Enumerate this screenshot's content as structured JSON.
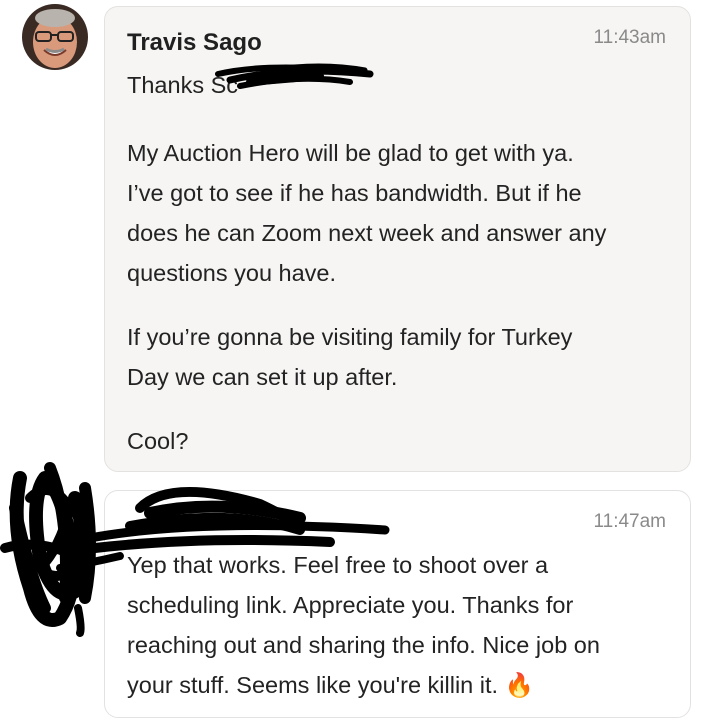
{
  "messages": [
    {
      "sender": "Travis Sago",
      "time": "11:43am",
      "greeting": "Thanks Sc",
      "paragraphs": [
        [
          "My Auction Hero will be glad to get with ya.",
          "I’ve got to see if he has bandwidth. But if he",
          "does he can Zoom next week and answer any",
          "questions you have."
        ],
        [
          "If you’re gonna be visiting family for Turkey",
          "Day we can set it up after."
        ],
        [
          "Cool?"
        ]
      ],
      "avatar_icon": "profile-photo"
    },
    {
      "sender": "",
      "time": "11:47am",
      "lines": [
        "Yep that works. Feel free to shoot over a",
        "scheduling link. Appreciate you. Thanks for",
        "reaching out and sharing the info. Nice job on",
        "your stuff. Seems like you're killin it. 🔥"
      ]
    }
  ],
  "colors": {
    "bubble_bg": "#f6f5f4",
    "bubble_border": "#e3e2e0",
    "time": "#8a8a8a",
    "redaction": "#000000"
  }
}
